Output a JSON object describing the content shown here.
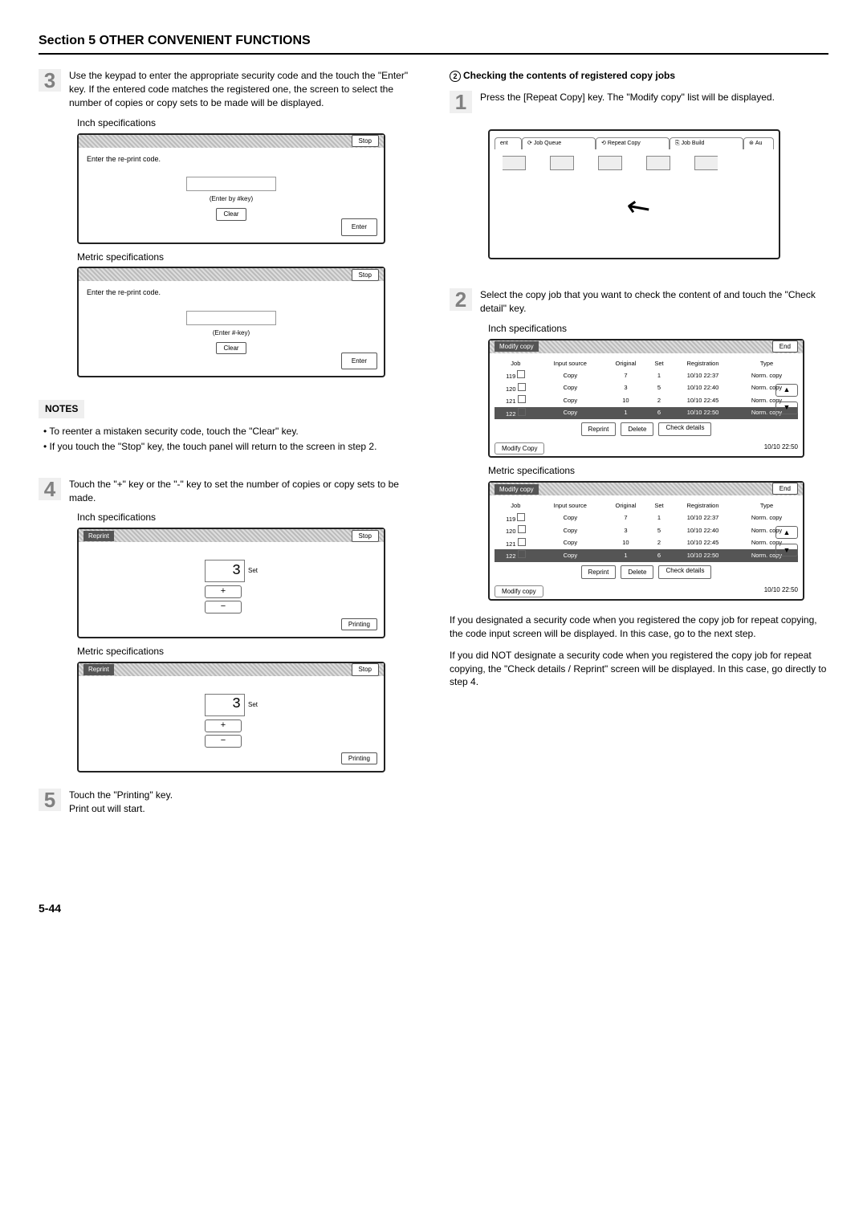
{
  "header": "Section 5  OTHER CONVENIENT FUNCTIONS",
  "page_number": "5-44",
  "left": {
    "step3": {
      "num": "3",
      "text": "Use the keypad to enter the appropriate security code and the touch the \"Enter\" key. If the entered code matches the registered one, the screen to select the number of copies or copy sets to be made will be displayed."
    },
    "spec_inch": "Inch specifications",
    "spec_metric": "Metric specifications",
    "screen_code": {
      "prompt": "Enter the re-print code.",
      "hint_inch": "(Enter by #key)",
      "hint_metric": "(Enter #-key)",
      "clear": "Clear",
      "enter": "Enter",
      "stop": "Stop"
    },
    "notes_title": "NOTES",
    "note1": "• To reenter a mistaken security code, touch the \"Clear\" key.",
    "note2": "• If you touch the \"Stop\" key, the touch panel will return to the screen in step 2.",
    "step4": {
      "num": "4",
      "text": "Touch the \"+\" key or the \"-\" key to set the number of copies or copy sets to be made."
    },
    "screen_set": {
      "title": "Reprint",
      "stop": "Stop",
      "value": "3",
      "set": "Set",
      "plus": "+",
      "minus": "−",
      "printing": "Printing"
    },
    "step5": {
      "num": "5",
      "text1": "Touch the \"Printing\" key.",
      "text2": "Print out will start."
    }
  },
  "right": {
    "heading_num": "2",
    "heading": "Checking the contents of registered copy jobs",
    "step1": {
      "num": "1",
      "text": "Press the [Repeat Copy] key. The \"Modify copy\" list will be displayed."
    },
    "tabs": {
      "t0": "ent",
      "t1": "Job Queue",
      "t2": "Repeat Copy",
      "t3": "Job Build",
      "t4": "Au"
    },
    "step2": {
      "num": "2",
      "text": "Select the copy job that you want to check the content of and touch the \"Check detail\" key."
    },
    "spec_inch": "Inch specifications",
    "spec_metric": "Metric specifications",
    "table": {
      "title": "Modify copy",
      "end": "End",
      "footer_inch": "Modify Copy",
      "footer_metric": "Modify copy",
      "clock": "10/10  22:50",
      "cols": {
        "c1": "Job",
        "c2": "Input source",
        "c3": "Original",
        "c4": "Set",
        "c5": "Registration",
        "c6": "Type"
      },
      "rows": [
        {
          "job": "119",
          "src": "Copy",
          "orig": "7",
          "set": "1",
          "reg": "10/10  22:37",
          "type": "Norm. copy"
        },
        {
          "job": "120",
          "src": "Copy",
          "orig": "3",
          "set": "5",
          "reg": "10/10  22:40",
          "type": "Norm. copy"
        },
        {
          "job": "121",
          "src": "Copy",
          "orig": "10",
          "set": "2",
          "reg": "10/10  22:45",
          "type": "Norm. copy"
        },
        {
          "job": "122",
          "src": "Copy",
          "orig": "1",
          "set": "6",
          "reg": "10/10  22:50",
          "type": "Norm. copy"
        }
      ],
      "actions": {
        "reprint": "Reprint",
        "delete": "Delete",
        "check": "Check details"
      },
      "up": "▲",
      "down": "▼"
    },
    "para1": "If you designated a security code when you registered the copy job for repeat copying, the code input screen will be displayed. In this case, go to the next step.",
    "para2": "If you did NOT designate a security code when you registered the copy job for repeat copying, the \"Check details / Reprint\" screen will be displayed. In this case, go directly to step 4."
  }
}
